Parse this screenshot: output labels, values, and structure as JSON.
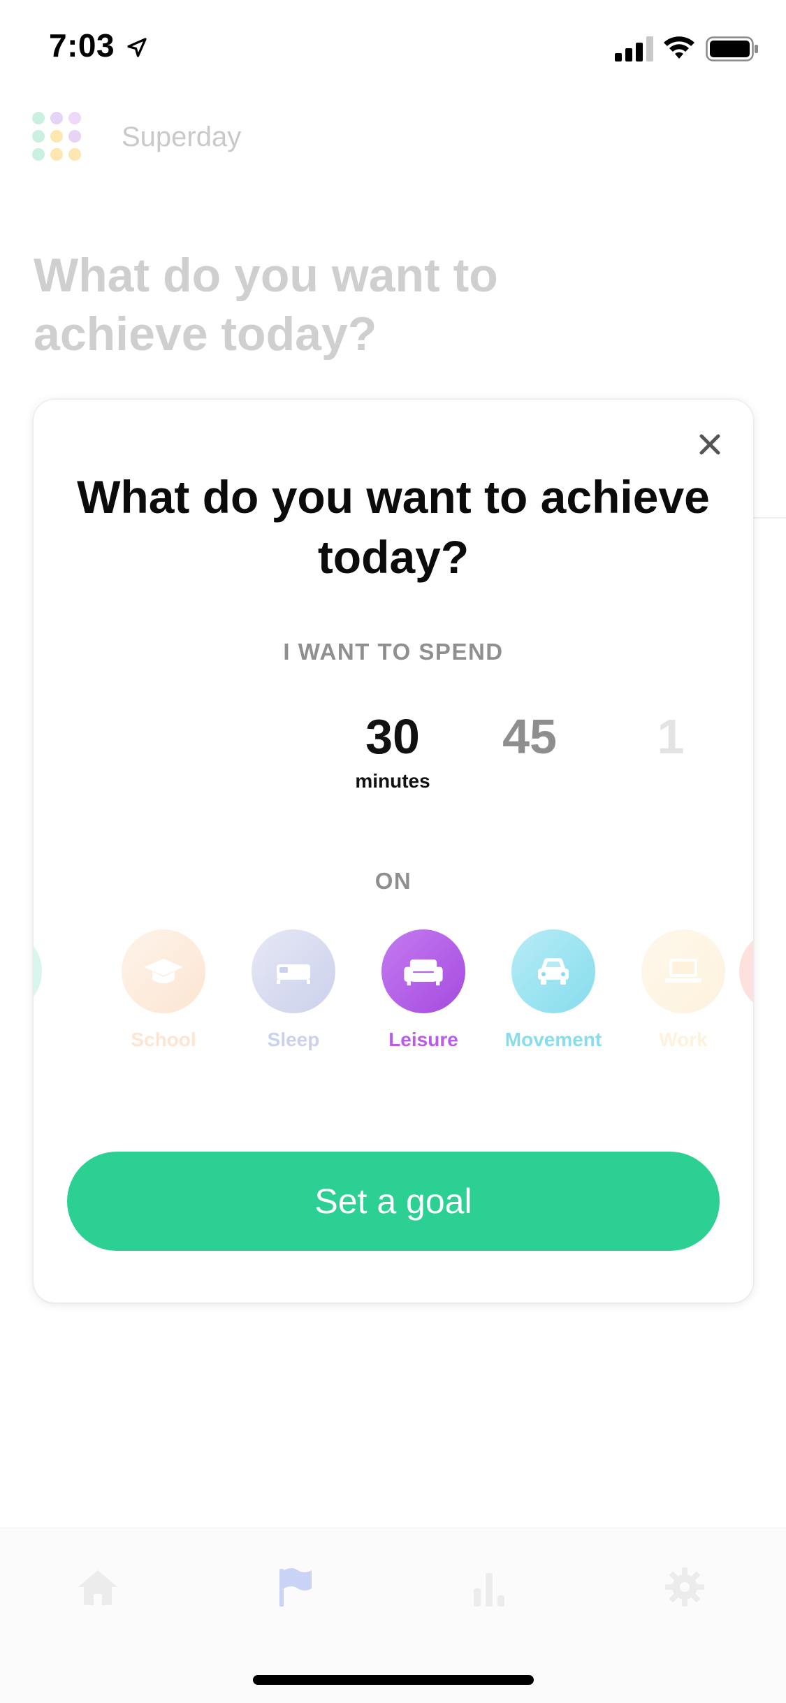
{
  "status_bar": {
    "time": "7:03",
    "icons": [
      "location-arrow-icon",
      "signal-icon",
      "wifi-icon",
      "battery-icon"
    ]
  },
  "app": {
    "title": "Superday",
    "logo_icon": "dot-grid-logo"
  },
  "background": {
    "heading": "What do you want to achieve today?"
  },
  "modal": {
    "title": "What do you want to achieve today?",
    "close_icon": "close-icon",
    "spend_label": "I WANT TO SPEND",
    "durations": [
      {
        "value": "30",
        "unit": "minutes",
        "selected": true
      },
      {
        "value": "45",
        "unit": "",
        "selected": false
      },
      {
        "value": "1",
        "unit": "",
        "selected": false
      }
    ],
    "on_label": "ON",
    "categories": [
      {
        "label": "School",
        "icon": "graduation-cap-icon",
        "color": "#f7a55f",
        "selected": false
      },
      {
        "label": "Sleep",
        "icon": "bed-icon",
        "color": "#8e9ad6",
        "selected": false
      },
      {
        "label": "Leisure",
        "icon": "couch-icon",
        "color": "#b95ce8",
        "selected": true
      },
      {
        "label": "Movement",
        "icon": "car-icon",
        "color": "#5fd1e8",
        "selected": false
      },
      {
        "label": "Work",
        "icon": "laptop-icon",
        "color": "#fbc56a",
        "selected": false
      }
    ],
    "button_label": "Set a goal",
    "button_color": "#2bd092"
  },
  "tab_bar": {
    "tabs": [
      {
        "name": "home",
        "icon": "home-icon",
        "active": false
      },
      {
        "name": "goals",
        "icon": "flag-icon",
        "active": true
      },
      {
        "name": "stats",
        "icon": "bar-chart-icon",
        "active": false
      },
      {
        "name": "settings",
        "icon": "gear-icon",
        "active": false
      }
    ]
  }
}
